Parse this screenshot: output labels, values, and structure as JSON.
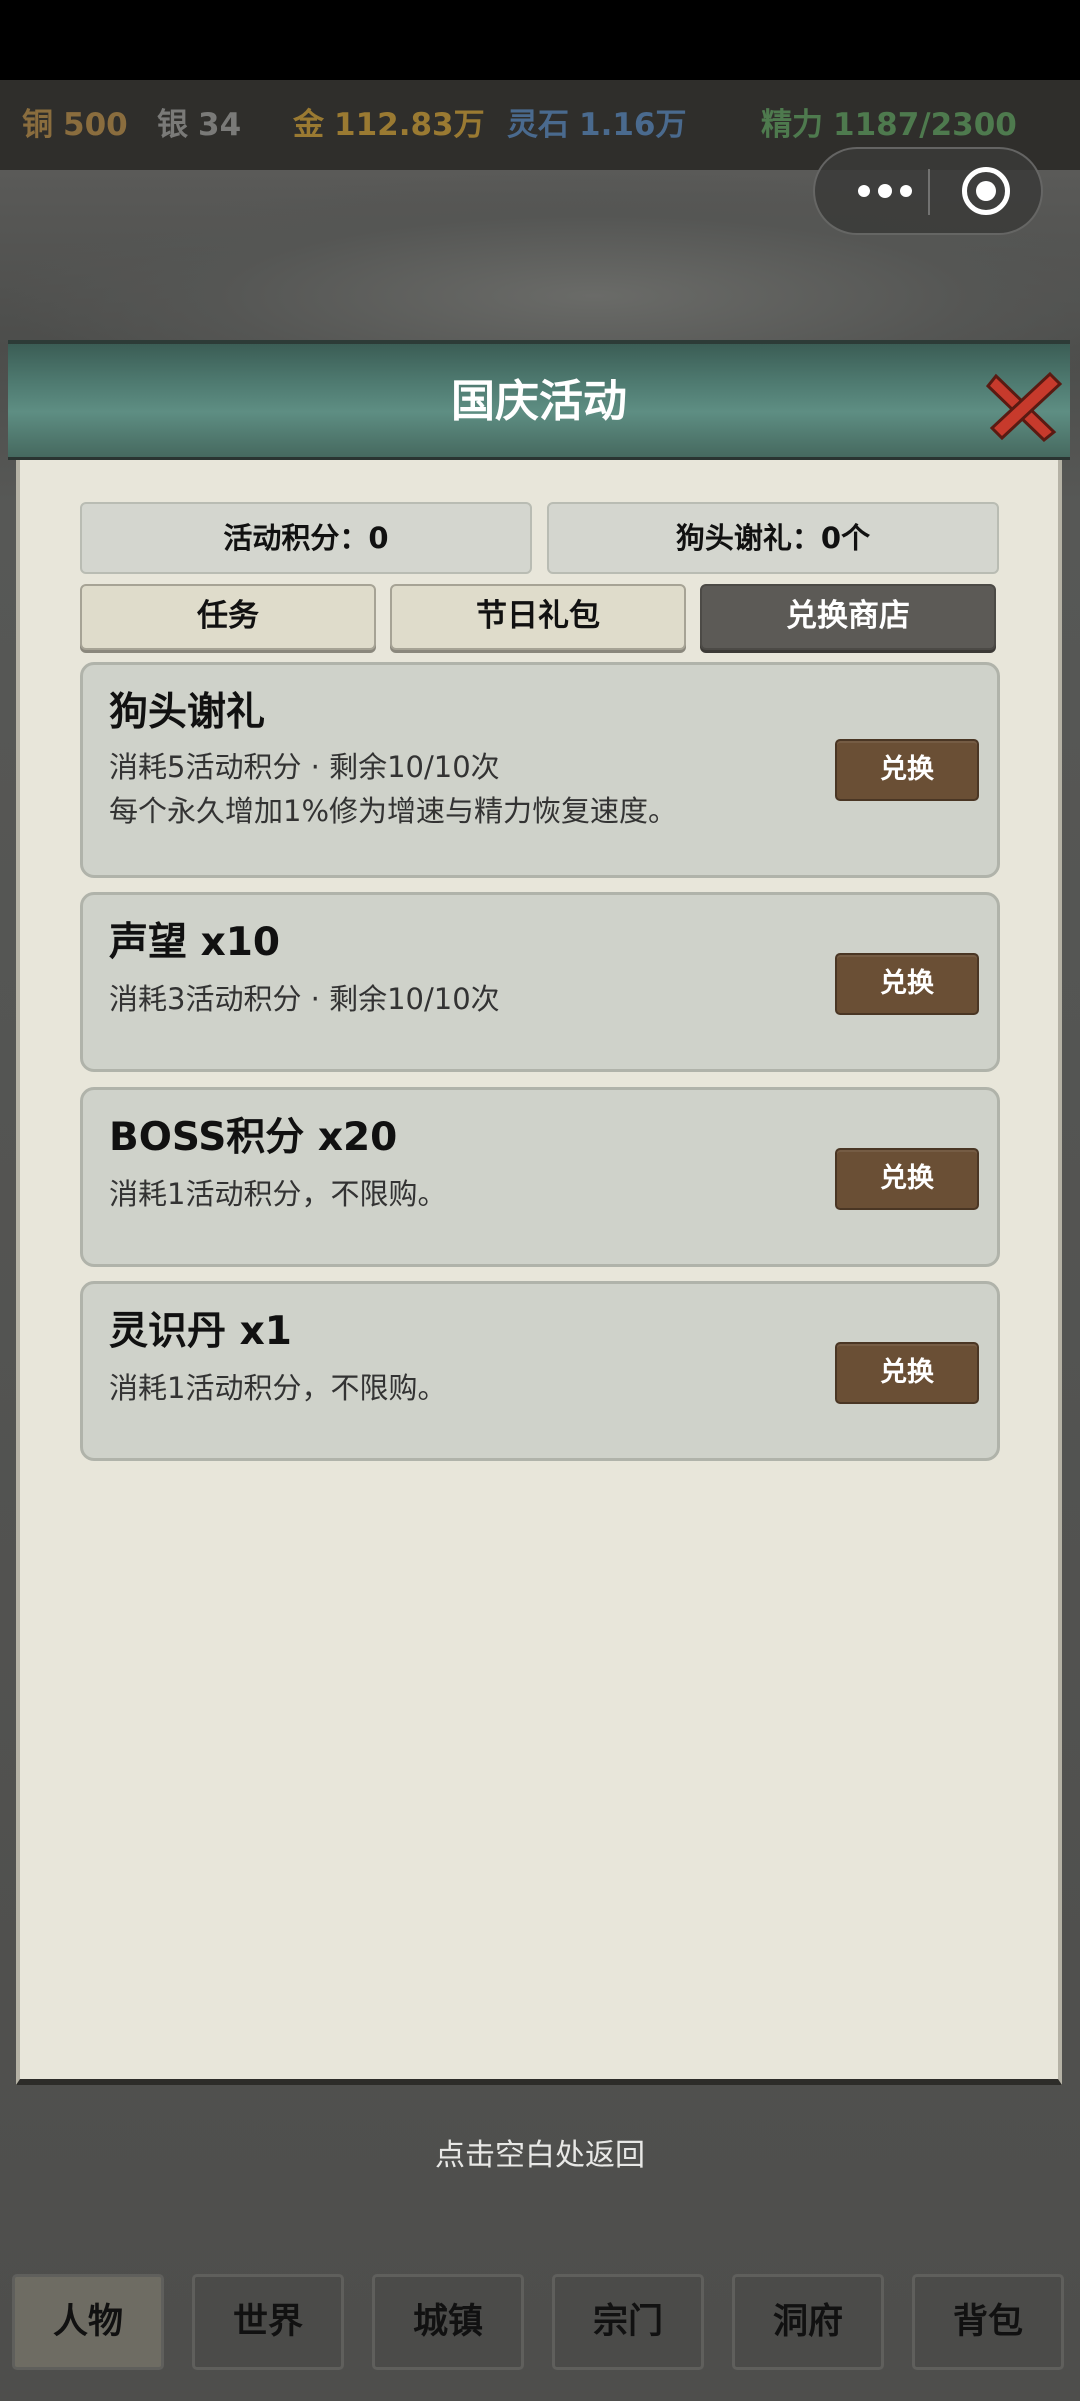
{
  "resources": {
    "copper": {
      "label": "铜",
      "value": "500",
      "color": "#8a6d3e"
    },
    "silver": {
      "label": "银",
      "value": "34",
      "color": "#7a7a78"
    },
    "gold": {
      "label": "金",
      "value": "112.83万",
      "color": "#9a7a32"
    },
    "spirit_stone": {
      "label": "灵石",
      "value": "1.16万",
      "color": "#4a6a8e"
    },
    "energy": {
      "label": "精力",
      "value": "1187/2300",
      "color": "#4e7a4e"
    }
  },
  "dialog": {
    "title": "国庆活动",
    "stats": {
      "points": "活动积分：0",
      "gift": "狗头谢礼：0个"
    },
    "tabs": [
      {
        "label": "任务"
      },
      {
        "label": "节日礼包"
      },
      {
        "label": "兑换商店",
        "active": true
      }
    ],
    "items": [
      {
        "title": "狗头谢礼",
        "desc1": "消耗5活动积分 · 剩余10/10次",
        "desc2": "每个永久增加1%修为增速与精力恢复速度。",
        "button": "兑换"
      },
      {
        "title": "声望 x10",
        "desc1": "消耗3活动积分 · 剩余10/10次",
        "button": "兑换"
      },
      {
        "title": "BOSS积分 x20",
        "desc1": "消耗1活动积分，不限购。",
        "button": "兑换"
      },
      {
        "title": "灵识丹 x1",
        "desc1": "消耗1活动积分，不限购。",
        "button": "兑换"
      }
    ]
  },
  "hint": "点击空白处返回",
  "nav": [
    {
      "label": "人物",
      "active": true
    },
    {
      "label": "世界"
    },
    {
      "label": "城镇"
    },
    {
      "label": "宗门"
    },
    {
      "label": "洞府"
    },
    {
      "label": "背包"
    }
  ]
}
